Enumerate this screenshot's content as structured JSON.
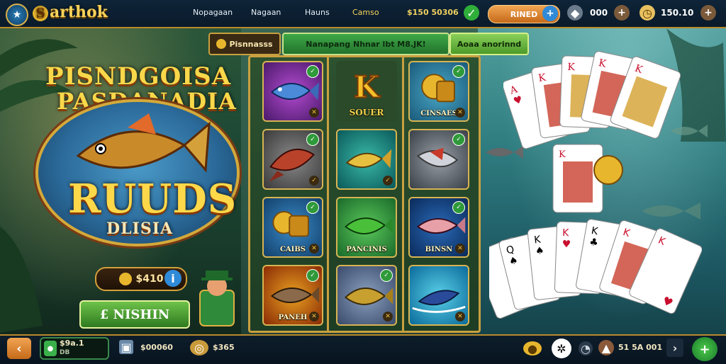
{
  "topbar": {
    "logo_letter": "S",
    "logo_text": "arthok",
    "nav": [
      "Nopagaan",
      "Nagaan",
      "Hauns",
      "Camso"
    ],
    "coins": "$150 50306",
    "gold_button": "RINED",
    "count": "000",
    "balance": "150.10"
  },
  "tabs": {
    "tab1": "Pisnnasss",
    "tab2": "Nanapang Nhnar lbt M8.JK!",
    "tab3": "Aoaa anorinnd"
  },
  "promo": {
    "title_line1": "PISNDGOISA",
    "title_line2": "PASDANADIA",
    "ribbon_main": "RUUDS",
    "ribbon_sub": "DLISIA",
    "coin_value": "$410",
    "action_button": "£ NISHIN"
  },
  "tiles": [
    {
      "label": "",
      "kind": "purple-fish"
    },
    {
      "label": "SOUER",
      "kind": "k-letter"
    },
    {
      "label": "CINSAES",
      "kind": "gold-coins"
    },
    {
      "label": "",
      "kind": "red-fish"
    },
    {
      "label": "",
      "kind": "yellow-fish"
    },
    {
      "label": "",
      "kind": "silver-fish"
    },
    {
      "label": "CAIBS",
      "kind": "gold-coins-2"
    },
    {
      "label": "PANCINIS",
      "kind": "green-fish"
    },
    {
      "label": "BINSN",
      "kind": "blue-fish"
    },
    {
      "label": "PANEH",
      "kind": "fire-fish"
    },
    {
      "label": "",
      "kind": "golden-fish"
    },
    {
      "label": "",
      "kind": "splash-fish"
    }
  ],
  "bottom": {
    "balance_label": "$9a.1",
    "balance_sub": "DB",
    "gems": "$00060",
    "coins": "$365",
    "status": "51 5A 001"
  },
  "colors": {
    "gold": "#c9a040",
    "green": "#2f9a3a",
    "orange": "#e3862a"
  }
}
